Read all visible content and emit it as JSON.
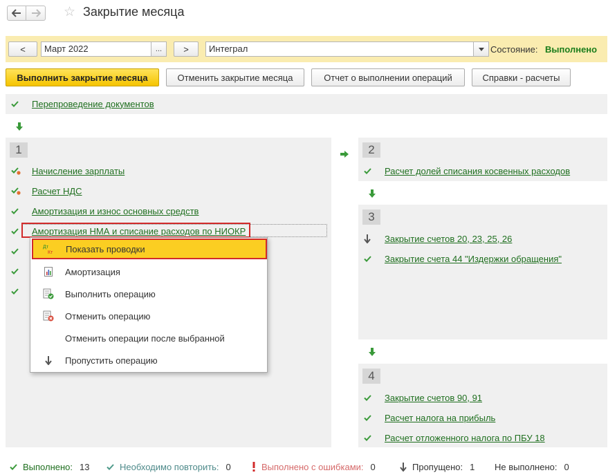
{
  "window": {
    "title": "Закрытие месяца"
  },
  "toolbar": {
    "prev_label": "<",
    "period_value": "Март 2022",
    "period_choose": "...",
    "next_label": ">",
    "org_value": "Интеграл",
    "state_label": "Состояние:",
    "state_value": "Выполнено",
    "state_color": "#1b7d1b"
  },
  "commands": {
    "run": "Выполнить закрытие месяца",
    "cancel": "Отменить закрытие месяца",
    "report": "Отчет о выполнении операций",
    "refs": "Справки - расчеты"
  },
  "top_panel": {
    "op": "Перепроведение документов"
  },
  "group1": {
    "num": "1",
    "ops": [
      "Начисление зарплаты",
      "Расчет НДС",
      "Амортизация и износ основных средств",
      "Амортизация НМА и списание расходов по НИОКР"
    ]
  },
  "group2": {
    "num": "2",
    "ops": [
      "Расчет долей списания косвенных расходов"
    ]
  },
  "group3": {
    "num": "3",
    "ops": [
      "Закрытие счетов 20, 23, 25, 26",
      "Закрытие счета 44 \"Издержки обращения\""
    ]
  },
  "group4": {
    "num": "4",
    "ops": [
      "Закрытие счетов 90, 91",
      "Расчет налога на прибыль",
      "Расчет отложенного налога по ПБУ 18"
    ]
  },
  "context_menu": {
    "items": [
      {
        "label": "Показать проводки",
        "icon": "dt-kt-icon"
      },
      {
        "label": "Амортизация",
        "icon": "report-icon"
      },
      {
        "label": "Выполнить операцию",
        "icon": "run-operation-icon"
      },
      {
        "label": "Отменить операцию",
        "icon": "cancel-operation-icon"
      },
      {
        "label": "Отменить операции после выбранной",
        "icon": ""
      },
      {
        "label": "Пропустить операцию",
        "icon": "skip-arrow-icon"
      }
    ],
    "dt_text": "Дт",
    "kt_text": "Кт"
  },
  "status": {
    "done_label": "Выполнено:",
    "done_count": "13",
    "repeat_label": "Необходимо повторить:",
    "repeat_count": "0",
    "errors_label": "Выполнено с ошибками:",
    "errors_count": "0",
    "skipped_label": "Пропущено:",
    "skipped_count": "1",
    "not_done_label": "Не выполнено:",
    "not_done_count": "0"
  },
  "colors": {
    "accent_yellow": "#f5c400",
    "link_green": "#1f6f1f",
    "check_green": "#3a9a3a",
    "error_red": "#d12a2a",
    "toolbar_bg": "#faecb0",
    "panel_bg": "#f0f0f0"
  }
}
